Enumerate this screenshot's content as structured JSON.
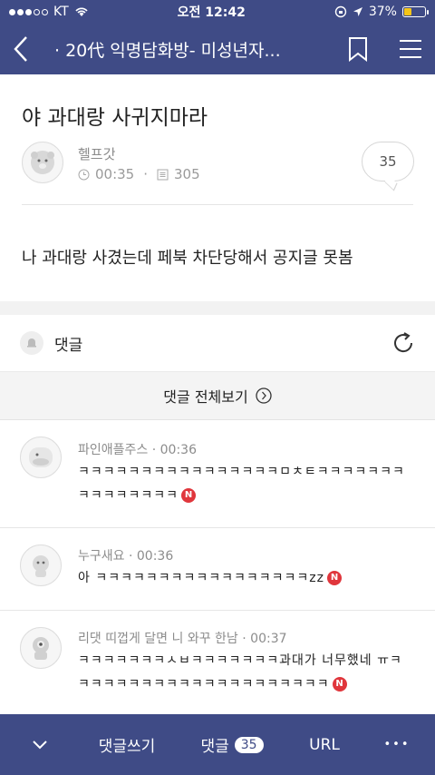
{
  "status_bar": {
    "carrier": "KT",
    "time": "오전 12:42",
    "battery": "37%",
    "battery_level": 0.37
  },
  "nav": {
    "title": "· 20代 익명담화방- 미성년자..."
  },
  "post": {
    "title": "야 과대랑 사귀지마라",
    "author": "헬프갓",
    "time": "00:35",
    "views": "305",
    "comment_count": "35",
    "body": "나 과대랑 사겼는데 페북 차단당해서 공지글 못봄"
  },
  "comments_section": {
    "label": "댓글",
    "view_all": "댓글 전체보기",
    "items": [
      {
        "author": "파인애플주스",
        "time": "00:36",
        "lines": [
          "ㅋㅋㅋㅋㅋㅋㅋㅋㅋㅋㅋㅋㅋㅋㅋㅋㅁㅊㅌㅋㅋㅋㅋㅋㅋㅋ",
          "ㅋㅋㅋㅋㅋㅋㅋㅋ"
        ],
        "badge": "N"
      },
      {
        "author": "누구새요",
        "time": "00:36",
        "lines": [
          "아 ㅋㅋㅋㅋㅋㅋㅋㅋㅋㅋㅋㅋㅋㅋㅋㅋㅋzz"
        ],
        "badge": "N"
      },
      {
        "author": "리댓 띠껍게 달면 니 와꾸 한남",
        "time": "00:37",
        "lines": [
          "ㅋㅋㅋㅋㅋㅋㅋㅅㅂㅋㅋㅋㅋㅋㅋㅋ과대가 너무했네 ㅠㅋ",
          "ㅋㅋㅋㅋㅋㅋㅋㅋㅋㅋㅋㅋㅋㅋㅋㅋㅋㅋㅋㅋ"
        ],
        "badge": "N"
      }
    ]
  },
  "bottom_bar": {
    "write_comment": "댓글쓰기",
    "comments": "댓글",
    "comment_count": "35",
    "url": "URL",
    "more": "•••"
  },
  "colors": {
    "header": "#3f4b86",
    "badge": "#e0363c",
    "battery": "#f5c518"
  }
}
